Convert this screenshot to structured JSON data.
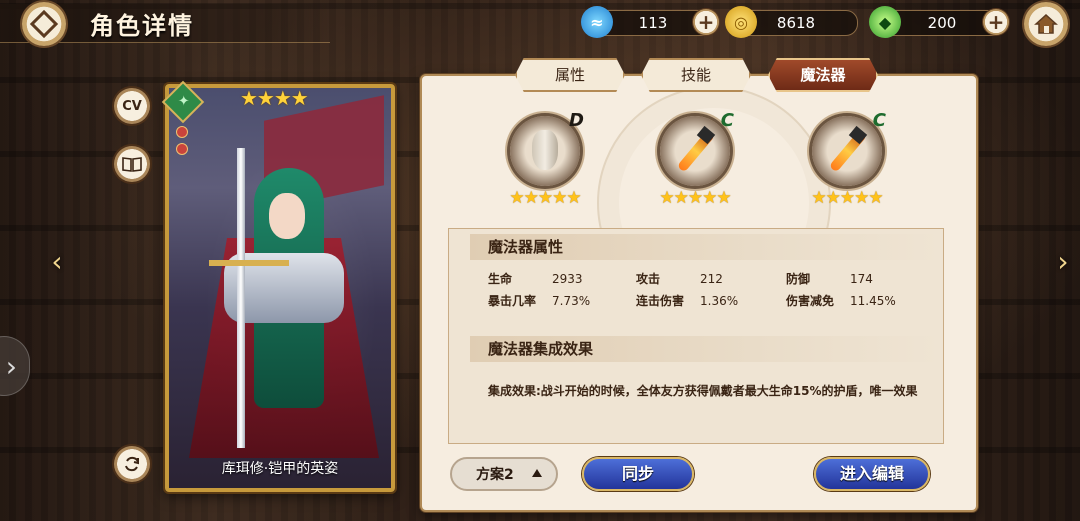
{
  "header": {
    "title": "角色详情"
  },
  "resources": [
    {
      "icon": "crystal-icon",
      "value": "113"
    },
    {
      "icon": "gold-coin-icon",
      "value": "8618"
    },
    {
      "icon": "leaf-gem-icon",
      "value": "200"
    }
  ],
  "side_buttons": {
    "cv_label": "CV"
  },
  "card": {
    "stars": "★★★★",
    "name": "库珥修·铠甲的英姿",
    "rarity_stars": 4
  },
  "tabs": [
    {
      "label": "属性",
      "active": false
    },
    {
      "label": "技能",
      "active": false
    },
    {
      "label": "魔法器",
      "active": true
    }
  ],
  "artifacts": [
    {
      "rank": "D",
      "rank_color": "#1f1a14",
      "stars": "★★★★★",
      "icon": "vase-icon"
    },
    {
      "rank": "C",
      "rank_color": "#1e6b2e",
      "stars": "★★★★★",
      "icon": "flame-blade-icon"
    },
    {
      "rank": "C",
      "rank_color": "#1e6b2e",
      "stars": "★★★★★",
      "icon": "flame-blade-icon"
    }
  ],
  "attributes": {
    "section_title": "魔法器属性",
    "rows": [
      [
        {
          "k": "生命",
          "v": "2933"
        },
        {
          "k": "攻击",
          "v": "212"
        },
        {
          "k": "防御",
          "v": "174"
        }
      ],
      [
        {
          "k": "暴击几率",
          "v": "7.73%"
        },
        {
          "k": "连击伤害",
          "v": "1.36%"
        },
        {
          "k": "伤害减免",
          "v": "11.45%"
        }
      ]
    ]
  },
  "set_effect": {
    "section_title": "魔法器集成效果",
    "text": "集成效果:战斗开始的时候，全体友方获得佩戴者最大生命15%的护盾，唯一效果"
  },
  "footer": {
    "plan_label": "方案2",
    "sync_label": "同步",
    "edit_label": "进入编辑"
  },
  "colors": {
    "active_tab": "#8a3a20",
    "panel_bg": "#f6ede0",
    "button_blue": "#2f46b5",
    "star": "#ffc21a"
  }
}
